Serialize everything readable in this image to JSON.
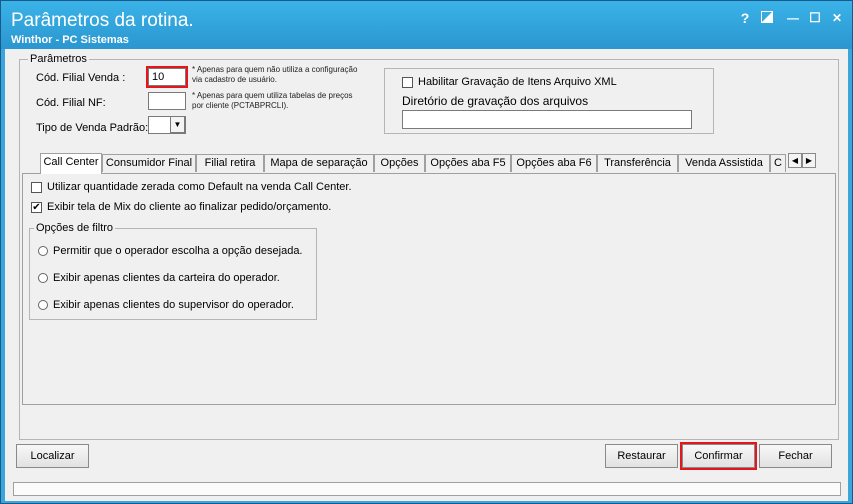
{
  "window": {
    "title": "Parâmetros da rotina.",
    "subtitle": "Winthor - PC Sistemas",
    "controls": {
      "help": "?",
      "minimize": "—",
      "maximize": "☐",
      "close": "✕"
    }
  },
  "params": {
    "legend": "Parâmetros",
    "filial_venda_label": "Cód. Filial Venda :",
    "filial_venda_value": "10",
    "filial_venda_note": "* Apenas para quem não utiliza a configuração via cadastro de usuário.",
    "filial_nf_label": "Cód. Filial NF:",
    "filial_nf_value": "",
    "filial_nf_note": "* Apenas para quem utiliza tabelas de preços por cliente (PCTABPRCLI).",
    "tipo_venda_label": "Tipo de Venda Padrão:",
    "tipo_venda_value": ""
  },
  "xml": {
    "checkbox_label": "Habilitar Gravação de Itens Arquivo XML",
    "checked": false,
    "dir_label": "Diretório de gravação dos arquivos",
    "dir_value": ""
  },
  "tabs": [
    "Call Center",
    "Consumidor Final",
    "Filial retira",
    "Mapa de separação",
    "Opções",
    "Opções aba F5",
    "Opções aba F6",
    "Transferência",
    "Venda Assistida",
    "C"
  ],
  "active_tab": "Call Center",
  "call_center": {
    "opt1_label": "Utilizar quantidade zerada como Default na venda Call Center.",
    "opt1_checked": false,
    "opt2_label": "Exibir tela de Mix do cliente ao finalizar pedido/orçamento.",
    "opt2_checked": true,
    "filter_legend": "Opções de filtro",
    "filter_options": [
      "Permitir que o operador escolha a opção desejada.",
      "Exibir apenas clientes da carteira do operador.",
      "Exibir apenas clientes do supervisor do operador."
    ]
  },
  "buttons": {
    "localizar": "Localizar",
    "restaurar": "Restaurar",
    "confirmar": "Confirmar",
    "fechar": "Fechar"
  },
  "colors": {
    "title_bar": "#2b96d0",
    "highlight": "#e4161b"
  }
}
